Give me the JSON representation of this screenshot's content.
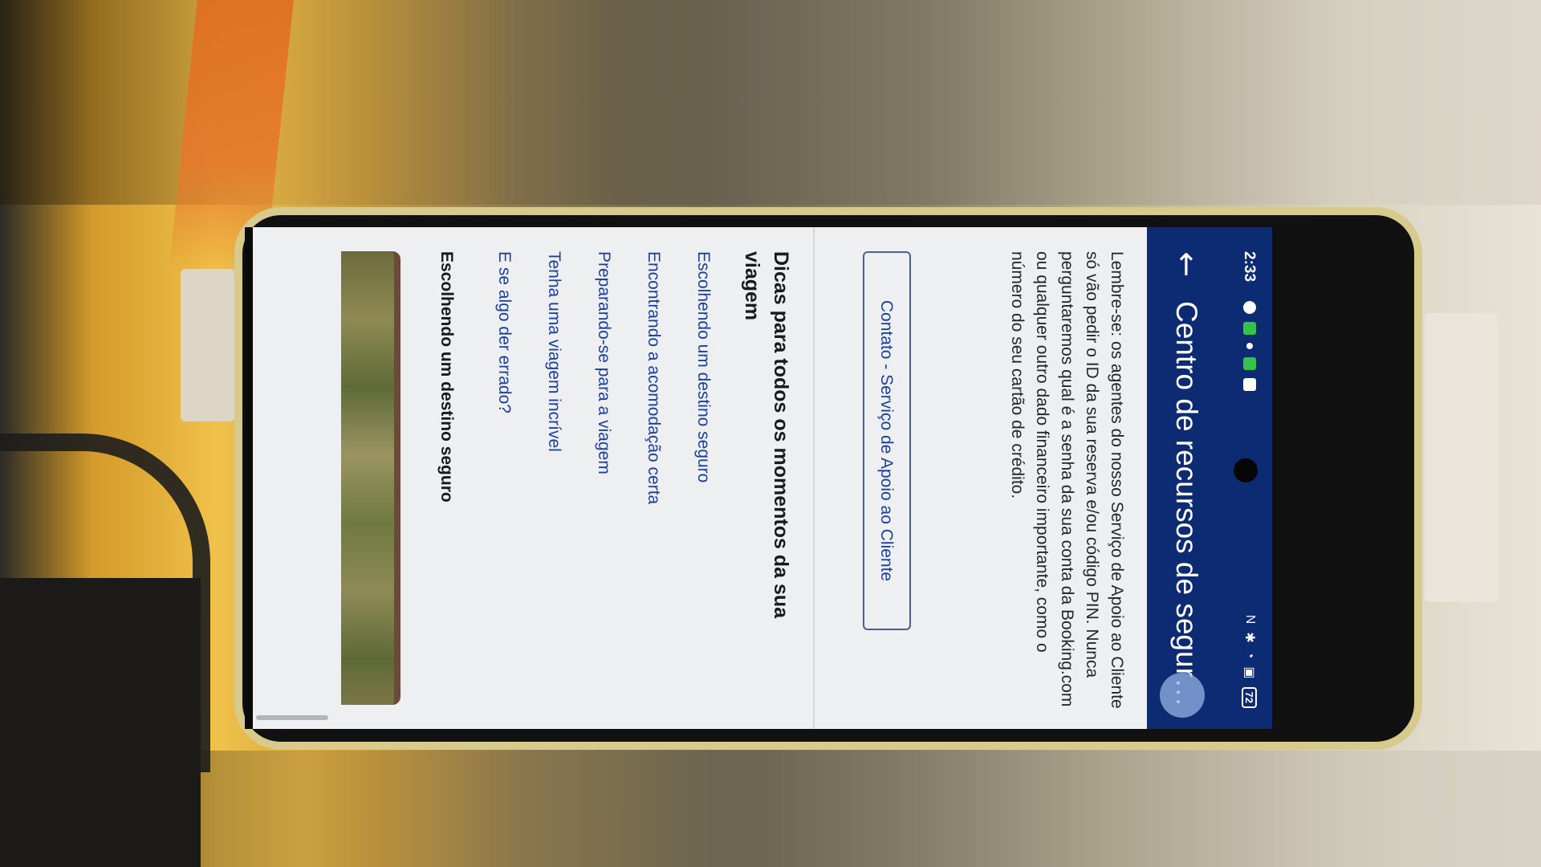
{
  "status_bar": {
    "time": "2:33",
    "battery": "72"
  },
  "header": {
    "title": "Centro de recursos de segura..."
  },
  "content": {
    "reminder": "Lembre-se: os agentes do nosso Serviço de Apoio ao Cliente só vão pedir o ID da sua reserva e/ou código PIN. Nunca perguntaremos qual é a senha da sua conta da Booking.com ou qualquer outro dado financeiro importante, como o número do seu cartão de crédito.",
    "contact_button": "Contato - Serviço de Apoio ao Cliente",
    "section_title": "Dicas para todos os momentos da sua viagem",
    "tips": [
      "Escolhendo um destino seguro",
      "Encontrando a acomodação certa",
      "Preparando-se para a viagem",
      "Tenha uma viagem incrível",
      "E se algo der errado?"
    ],
    "subsection_title": "Escolhendo um destino seguro"
  },
  "colors": {
    "header_bg": "#0d2b72",
    "link": "#1d3f9c",
    "content_bg": "#eeeff1"
  },
  "icons": {
    "back": "arrow-left-icon",
    "nav_recents": "square-icon",
    "nav_home": "circle-icon",
    "nav_back": "triangle-icon"
  }
}
